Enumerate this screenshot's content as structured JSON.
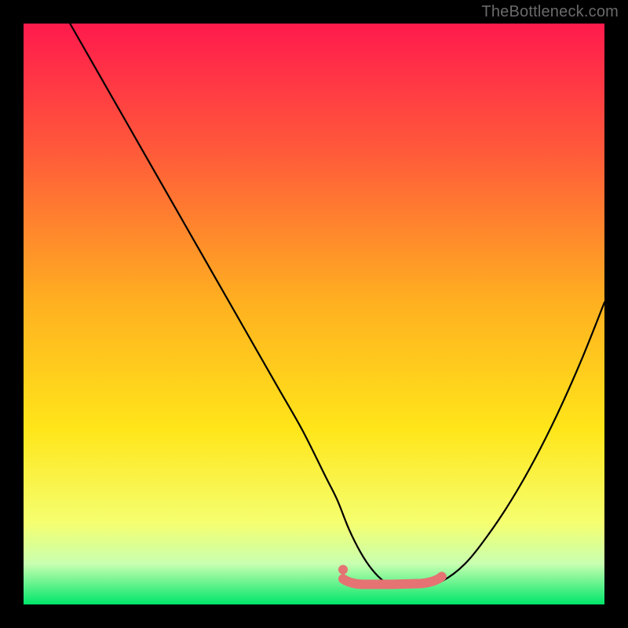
{
  "attribution": "TheBottleneck.com",
  "colors": {
    "page_bg": "#000000",
    "gradient_stops": [
      {
        "offset": "0%",
        "color": "#ff1a4d"
      },
      {
        "offset": "22%",
        "color": "#ff5a3a"
      },
      {
        "offset": "48%",
        "color": "#ffb020"
      },
      {
        "offset": "70%",
        "color": "#ffe61a"
      },
      {
        "offset": "86%",
        "color": "#f5ff70"
      },
      {
        "offset": "93%",
        "color": "#c8ffb0"
      },
      {
        "offset": "100%",
        "color": "#00e66a"
      }
    ],
    "curve_stroke": "#000000",
    "optimal_stroke": "#e57373"
  },
  "chart_data": {
    "type": "line",
    "title": "",
    "xlabel": "",
    "ylabel": "",
    "xlim": [
      0,
      100
    ],
    "ylim": [
      0,
      100
    ],
    "x": [
      8,
      12,
      16,
      20,
      24,
      28,
      32,
      36,
      40,
      44,
      48,
      52,
      54,
      56,
      58,
      60,
      62,
      64,
      66,
      68,
      72,
      76,
      80,
      84,
      88,
      92,
      96,
      100
    ],
    "values": [
      100,
      93,
      86,
      79,
      72,
      65,
      58,
      51,
      44,
      37,
      30,
      22,
      18,
      13,
      9,
      6,
      4,
      3,
      3,
      3,
      4,
      7,
      12,
      18,
      25,
      33,
      42,
      52
    ],
    "optimal_zone": {
      "x_start": 55,
      "x_end": 72,
      "y": 4
    },
    "optimal_point": {
      "x": 55,
      "y": 6
    }
  }
}
